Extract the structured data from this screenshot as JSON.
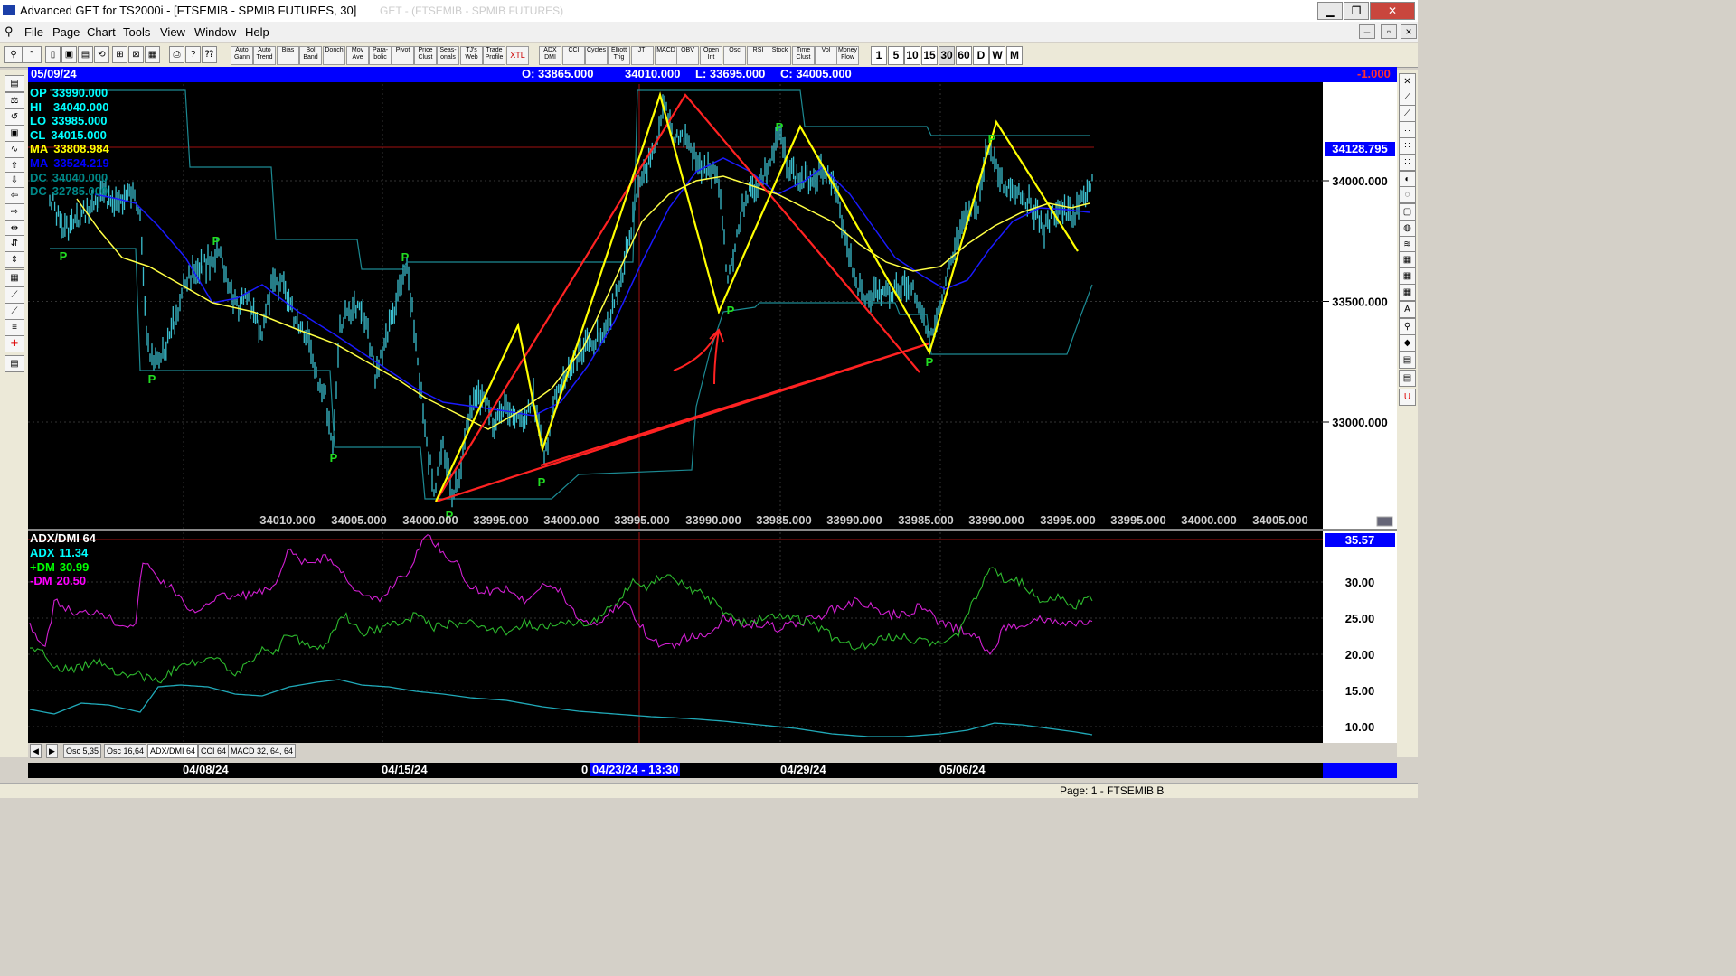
{
  "window": {
    "title": "Advanced GET for TS2000i - [FTSEMIB - SPMIB FUTURES, 30]",
    "ghost_text": "GET - (FTSEMIB - SPMIB FUTURES)"
  },
  "menu": [
    "File",
    "Page",
    "Chart",
    "Tools",
    "View",
    "Window",
    "Help"
  ],
  "toolbar_buttons": [
    "Auto Gann",
    "Auto Trend",
    "Bias",
    "Bol Band",
    "Donch",
    "Mov Ave",
    "Para-bolic",
    "Pivot",
    "Price Clust",
    "Seas-onals",
    "TJ's Web",
    "Trade Profile",
    "XTL",
    "ADX DMI",
    "CCI",
    "Cycles",
    "Elliott Trig",
    "JTI",
    "MACD",
    "OBV",
    "Open Int",
    "Osc",
    "RSI",
    "Stock",
    "Time Clust",
    "Vol",
    "Money Flow"
  ],
  "timeframes": [
    "1",
    "5",
    "10",
    "15",
    "30",
    "60",
    "D",
    "W",
    "M"
  ],
  "infobar": {
    "date": "05/09/24",
    "open": "O: 33865.000",
    "high": "34010.000",
    "low": "L: 33695.000",
    "close": "C: 34005.000",
    "change": "-1.000"
  },
  "price_panel": {
    "legend": [
      {
        "label": "OP",
        "value": "33990.000",
        "color": "#00ffff"
      },
      {
        "label": "HI",
        "value": "34040.000",
        "color": "#00ffff"
      },
      {
        "label": "LO",
        "value": "33985.000",
        "color": "#00ffff"
      },
      {
        "label": "CL",
        "value": "34015.000",
        "color": "#00ffff"
      },
      {
        "label": "MA",
        "value": "33808.984",
        "color": "#ffff00"
      },
      {
        "label": "MA",
        "value": "33524.219",
        "color": "#0000ff"
      },
      {
        "label": "DC",
        "value": "34040.000",
        "color": "#008888"
      },
      {
        "label": "DC",
        "value": "32785.000",
        "color": "#008888"
      }
    ],
    "scale_labels": [
      "34000.000",
      "33500.000",
      "33000.000"
    ],
    "current_price": "34128.795",
    "pivot_labels": [
      "P",
      "P",
      "P",
      "P",
      "P",
      "P",
      "P",
      "P",
      "P",
      "P",
      "P",
      "P"
    ],
    "bottom_values": [
      "34010.000",
      "34005.000",
      "34000.000",
      "33995.000",
      "34000.000",
      "33995.000",
      "33990.000",
      "33985.000",
      "33990.000",
      "33985.000",
      "33990.000",
      "33995.000",
      "33995.000",
      "34000.000",
      "34005.000"
    ]
  },
  "adx_panel": {
    "title": "ADX/DMI 64",
    "legend": [
      {
        "label": "ADX",
        "value": "11.34",
        "color": "#00ffff"
      },
      {
        "label": "+DM",
        "value": "30.99",
        "color": "#00ff00"
      },
      {
        "label": "-DM",
        "value": "20.50",
        "color": "#ff00ff"
      }
    ],
    "current": "35.57",
    "scale_labels": [
      "30.00",
      "25.00",
      "20.00",
      "15.00",
      "10.00"
    ]
  },
  "tabs": [
    "Osc 5,35",
    "Osc 16,64",
    "ADX/DMI 64",
    "CCI 64",
    "MACD 32, 64, 64"
  ],
  "dates": {
    "d1": "04/08/24",
    "d2": "04/15/24",
    "cursor_prefix": "0",
    "cursor": "04/23/24 - 13:30",
    "d3": "04/29/24",
    "d4": "05/06/24"
  },
  "status": "Page: 1 - FTSEMIB B",
  "chart_data": {
    "type": "line",
    "price_scale": {
      "labels": [
        34000,
        33500,
        33000
      ],
      "marked_level": 34128.795
    },
    "legend_values": {
      "OP": 33990.0,
      "HI": 34040.0,
      "LO": 33985.0,
      "CL": 34015.0,
      "MA_yellow": 33808.984,
      "MA_blue": 33524.219,
      "DC_upper": 34040.0,
      "DC_lower": 32785.0
    },
    "adx": {
      "ADX": 11.34,
      "plusDM": 30.99,
      "minusDM": 20.5,
      "scale": [
        30,
        25,
        20,
        15,
        10
      ],
      "marked_level": 35.57
    }
  }
}
